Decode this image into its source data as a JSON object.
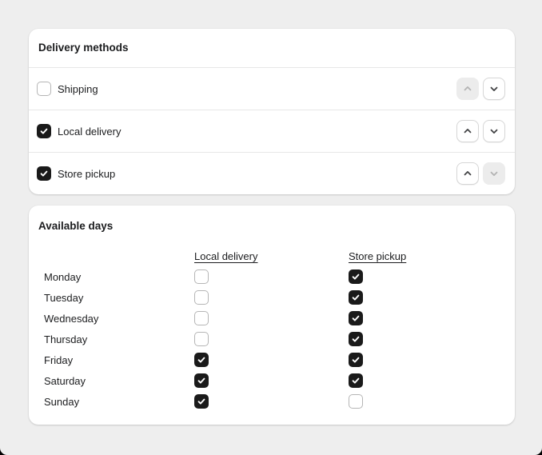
{
  "delivery_methods_card": {
    "title": "Delivery methods",
    "rows": [
      {
        "label": "Shipping",
        "checked": false,
        "up_enabled": false,
        "down_enabled": true
      },
      {
        "label": "Local delivery",
        "checked": true,
        "up_enabled": true,
        "down_enabled": true
      },
      {
        "label": "Store pickup",
        "checked": true,
        "up_enabled": true,
        "down_enabled": false
      }
    ]
  },
  "available_days_card": {
    "title": "Available days",
    "columns": [
      "Local delivery",
      "Store pickup"
    ],
    "rows": [
      {
        "day": "Monday",
        "local_delivery": false,
        "store_pickup": true
      },
      {
        "day": "Tuesday",
        "local_delivery": false,
        "store_pickup": true
      },
      {
        "day": "Wednesday",
        "local_delivery": false,
        "store_pickup": true
      },
      {
        "day": "Thursday",
        "local_delivery": false,
        "store_pickup": true
      },
      {
        "day": "Friday",
        "local_delivery": true,
        "store_pickup": true
      },
      {
        "day": "Saturday",
        "local_delivery": true,
        "store_pickup": true
      },
      {
        "day": "Sunday",
        "local_delivery": true,
        "store_pickup": false
      }
    ]
  },
  "icons": {
    "chevron_up": "chevron-up-icon",
    "chevron_down": "chevron-down-icon",
    "checkmark": "checkmark-icon"
  },
  "colors": {
    "page_background": "#eeeeee",
    "card_background": "#ffffff",
    "checkbox_checked": "#1a1a1a",
    "text": "#1c1d1f",
    "divider": "#e7e7e7",
    "disabled_button": "#ececec"
  }
}
